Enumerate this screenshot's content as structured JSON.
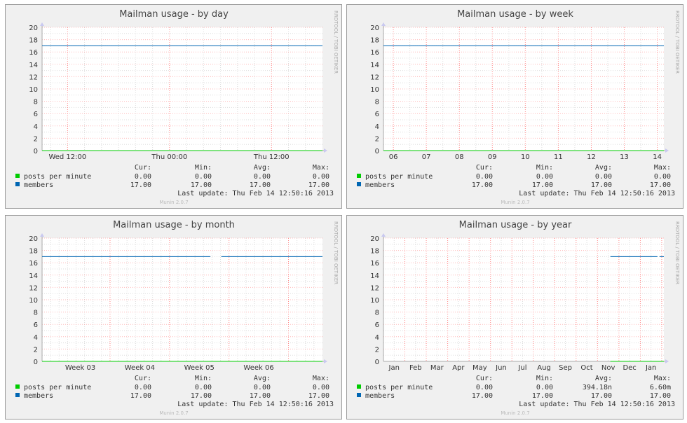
{
  "labels": {
    "cur": "Cur:",
    "min": "Min:",
    "avg": "Avg:",
    "max": "Max:",
    "last_update_label": "Last update:",
    "watermark": "RRDTOOL / TOBI OETIKER",
    "munin_version": "Munin 2.0.7"
  },
  "colors": {
    "posts_per_minute": "#00cc00",
    "members": "#0066b3",
    "major_grid": "#ff8c8c",
    "minor_grid": "#dddddd",
    "axis": "#aaaaaa",
    "panel_bg": "#f0f0f0",
    "plot_bg": "#ffffff",
    "text": "#333333",
    "footer_text": "#bbbbbb"
  },
  "chart_data": [
    {
      "type": "line",
      "title": "Mailman usage - by day",
      "ylim": [
        0,
        20
      ],
      "yticks": [
        0,
        2,
        4,
        6,
        8,
        10,
        12,
        14,
        16,
        18,
        20
      ],
      "x_range_hours": [
        0,
        33
      ],
      "x_tick_labels": [
        {
          "label": "Wed 12:00",
          "x": 3
        },
        {
          "label": "Thu 00:00",
          "x": 15
        },
        {
          "label": "Thu 12:00",
          "x": 27
        }
      ],
      "major_x": [
        3,
        15,
        27
      ],
      "minor_x": [
        1,
        5,
        7,
        9,
        11,
        13,
        17,
        19,
        21,
        23,
        25,
        29,
        31
      ],
      "series": [
        {
          "name": "posts per minute",
          "key": "posts_per_minute",
          "segments": [
            [
              [
                0,
                0
              ],
              [
                33,
                0
              ]
            ]
          ],
          "cur": "0.00",
          "min": "0.00",
          "avg": "0.00",
          "max": "0.00"
        },
        {
          "name": "members",
          "key": "members",
          "segments": [
            [
              [
                0,
                17
              ],
              [
                33,
                17
              ]
            ]
          ],
          "cur": "17.00",
          "min": "17.00",
          "avg": "17.00",
          "max": "17.00"
        }
      ],
      "last_update": "Thu Feb 14 12:50:16 2013",
      "grid": true
    },
    {
      "type": "line",
      "title": "Mailman usage - by week",
      "ylim": [
        0,
        20
      ],
      "yticks": [
        0,
        2,
        4,
        6,
        8,
        10,
        12,
        14,
        16,
        18,
        20
      ],
      "x_range_days": [
        0,
        8.5
      ],
      "x_tick_labels": [
        {
          "label": "06",
          "x": 0.3
        },
        {
          "label": "07",
          "x": 1.3
        },
        {
          "label": "08",
          "x": 2.3
        },
        {
          "label": "09",
          "x": 3.3
        },
        {
          "label": "10",
          "x": 4.3
        },
        {
          "label": "11",
          "x": 5.3
        },
        {
          "label": "12",
          "x": 6.3
        },
        {
          "label": "13",
          "x": 7.3
        },
        {
          "label": "14",
          "x": 8.3
        }
      ],
      "major_x": [
        0.3,
        1.3,
        2.3,
        3.3,
        4.3,
        5.3,
        6.3,
        7.3,
        8.3
      ],
      "minor_x": [
        0.8,
        1.8,
        2.8,
        3.8,
        4.8,
        5.8,
        6.8,
        7.8
      ],
      "series": [
        {
          "name": "posts per minute",
          "key": "posts_per_minute",
          "segments": [
            [
              [
                0,
                0
              ],
              [
                8.5,
                0
              ]
            ]
          ],
          "cur": "0.00",
          "min": "0.00",
          "avg": "0.00",
          "max": "0.00"
        },
        {
          "name": "members",
          "key": "members",
          "segments": [
            [
              [
                0,
                17
              ],
              [
                8.5,
                17
              ]
            ]
          ],
          "cur": "17.00",
          "min": "17.00",
          "avg": "17.00",
          "max": "17.00"
        }
      ],
      "last_update": "Thu Feb 14 12:50:16 2013",
      "grid": true
    },
    {
      "type": "line",
      "title": "Mailman usage - by month",
      "ylim": [
        0,
        20
      ],
      "yticks": [
        0,
        2,
        4,
        6,
        8,
        10,
        12,
        14,
        16,
        18,
        20
      ],
      "x_range_days": [
        0,
        33
      ],
      "x_tick_labels": [
        {
          "label": "Week 03",
          "x": 4.5
        },
        {
          "label": "Week 04",
          "x": 11.5
        },
        {
          "label": "Week 05",
          "x": 18.5
        },
        {
          "label": "Week 06",
          "x": 25.5
        }
      ],
      "major_x": [
        8,
        15,
        22,
        29
      ],
      "minor_x": [
        1,
        2,
        3,
        4,
        5,
        6,
        7,
        9,
        10,
        11,
        12,
        13,
        14,
        16,
        17,
        18,
        19,
        20,
        21,
        23,
        24,
        25,
        26,
        27,
        28,
        30,
        31,
        32
      ],
      "series": [
        {
          "name": "posts per minute",
          "key": "posts_per_minute",
          "segments": [
            [
              [
                0,
                0
              ],
              [
                33,
                0
              ]
            ]
          ],
          "cur": "0.00",
          "min": "0.00",
          "avg": "0.00",
          "max": "0.00"
        },
        {
          "name": "members",
          "key": "members",
          "segments": [
            [
              [
                0,
                17
              ],
              [
                19.8,
                17
              ]
            ],
            [
              [
                21.1,
                17
              ],
              [
                33,
                17
              ]
            ]
          ],
          "cur": "17.00",
          "min": "17.00",
          "avg": "17.00",
          "max": "17.00"
        }
      ],
      "last_update": "Thu Feb 14 12:50:16 2013",
      "grid": true
    },
    {
      "type": "line",
      "title": "Mailman usage - by year",
      "ylim": [
        0,
        20
      ],
      "yticks": [
        0,
        2,
        4,
        6,
        8,
        10,
        12,
        14,
        16,
        18,
        20
      ],
      "x_range_months": [
        0,
        13.1
      ],
      "x_tick_labels": [
        {
          "label": "Jan",
          "x": 0.5
        },
        {
          "label": "Feb",
          "x": 1.5
        },
        {
          "label": "Mar",
          "x": 2.5
        },
        {
          "label": "Apr",
          "x": 3.5
        },
        {
          "label": "May",
          "x": 4.5
        },
        {
          "label": "Jun",
          "x": 5.5
        },
        {
          "label": "Jul",
          "x": 6.5
        },
        {
          "label": "Aug",
          "x": 7.5
        },
        {
          "label": "Sep",
          "x": 8.5
        },
        {
          "label": "Oct",
          "x": 9.5
        },
        {
          "label": "Nov",
          "x": 10.5
        },
        {
          "label": "Dec",
          "x": 11.5
        },
        {
          "label": "Jan",
          "x": 12.5
        }
      ],
      "major_x": [
        1,
        2,
        3,
        4,
        5,
        6,
        7,
        8,
        9,
        10,
        11,
        12,
        13
      ],
      "minor_x": [
        0.5,
        1.5,
        2.5,
        3.5,
        4.5,
        5.5,
        6.5,
        7.5,
        8.5,
        9.5,
        10.5,
        11.5,
        12.5
      ],
      "series": [
        {
          "name": "posts per minute",
          "key": "posts_per_minute",
          "segments": [
            [
              [
                10.6,
                0
              ],
              [
                13.1,
                0
              ]
            ]
          ],
          "cur": "0.00",
          "min": "0.00",
          "avg": "394.18n",
          "max": "6.60m"
        },
        {
          "name": "members",
          "key": "members",
          "segments": [
            [
              [
                10.6,
                17
              ],
              [
                12.8,
                17
              ]
            ],
            [
              [
                12.9,
                17
              ],
              [
                13.1,
                17
              ]
            ]
          ],
          "cur": "17.00",
          "min": "17.00",
          "avg": "17.00",
          "max": "17.00"
        }
      ],
      "last_update": "Thu Feb 14 12:50:16 2013",
      "grid": true
    }
  ]
}
